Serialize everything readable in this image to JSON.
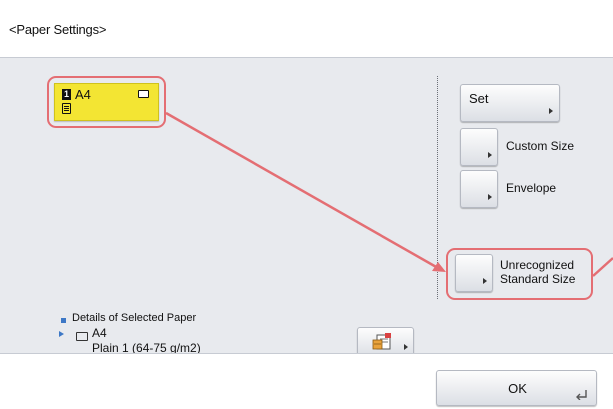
{
  "window": {
    "title": "<Paper Settings>"
  },
  "tray": {
    "number": "1",
    "size": "A4",
    "highlight_color": "#e46e73",
    "color": "#f3e533"
  },
  "buttons": {
    "set": "Set",
    "custom_size": "Custom Size",
    "envelope": "Envelope",
    "unrecognized": "Unrecognized Standard Size",
    "ok": "OK"
  },
  "details": {
    "label": "Details of Selected Paper",
    "size": "A4",
    "type": "Plain 1 (64-75 g/m2)"
  },
  "icons": {
    "tray_paper": "paper-icon",
    "tray_stack": "paper-stack-icon",
    "settings": "paper-settings-icon",
    "ok": "return-icon"
  },
  "colors": {
    "accent": "#3d78c6",
    "annotation": "#e46e73",
    "panel": "#e8eaee"
  }
}
